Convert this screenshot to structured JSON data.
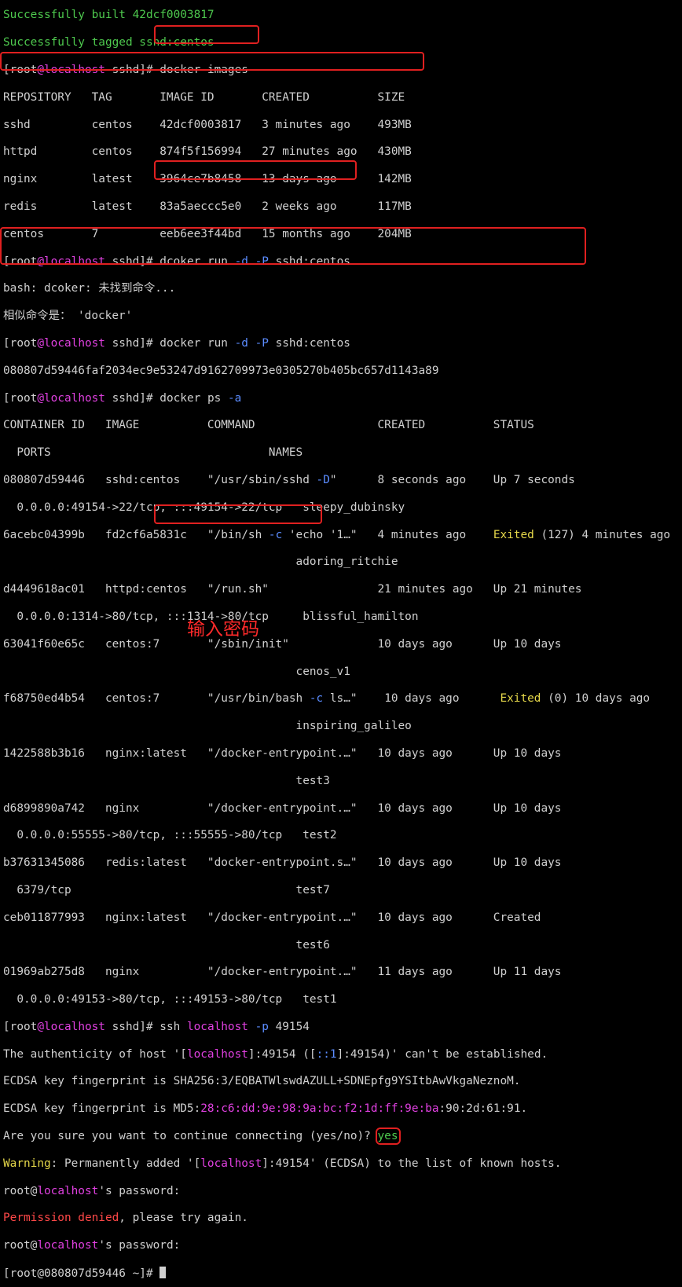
{
  "prompt": {
    "user": "root",
    "at": "@",
    "host": "localhost",
    "dir": " sshd]# ",
    "open": "["
  },
  "build": {
    "built": "Successfully built 42dcf0003817",
    "tagged": "Successfully tagged sshd:centos"
  },
  "cmd_images": "docker images",
  "images_header": "REPOSITORY   TAG       IMAGE ID       CREATED          SIZE",
  "images": [
    "sshd         centos    42dcf0003817   3 minutes ago    493MB",
    "httpd        centos    874f5f156994   27 minutes ago   430MB",
    "nginx        latest    3964ce7b8458   13 days ago      142MB",
    "redis        latest    83a5aeccc5e0   2 weeks ago      117MB",
    "centos       7         eeb6ee3f44bd   15 months ago    204MB"
  ],
  "typo_cmd": {
    "a": "dcoker run ",
    "d": "-d",
    "m": " ",
    "p": "-P",
    "z": " sshd:centos"
  },
  "bash_err": "bash: dcoker: 未找到命令...",
  "similar": "相似命令是： 'docker'",
  "run_cmd": {
    "a": "docker run ",
    "d": "-d",
    "m": " ",
    "p": "-P",
    "z": " sshd:centos"
  },
  "run_id": "080807d59446faf2034ec9e53247d9162709973e0305270b405bc657d1143a89",
  "ps_cmd": {
    "a": "docker ps ",
    "f": "-a"
  },
  "ps_header1": "CONTAINER ID   IMAGE          COMMAND                  CREATED          STATUS",
  "ps_header2": "  PORTS                                NAMES",
  "ps": {
    "r1a": "080807d59446   sshd:centos    \"/usr/sbin/sshd ",
    "r1f": "-D",
    "r1b": "\"      8 seconds ago    Up 7 seconds",
    "r1p": "  0.0.0.0:49154->22/tcp, :::49154->22/tcp   sleepy_dubinsky",
    "r2a": "6acebc04399b   fd2cf6a5831c   \"/bin/sh ",
    "r2f": "-c",
    "r2b": " 'echo '1…\"   4 minutes ago    ",
    "r2s": "Exited",
    "r2c": " (127) 4 minutes ago",
    "r2n": "                                           adoring_ritchie",
    "r3a": "d4449618ac01   httpd:centos   \"/run.sh\"                21 minutes ago   Up 21 minutes",
    "r3p": "  0.0.0.0:1314->80/tcp, :::1314->80/tcp     blissful_hamilton",
    "r4a": "63041f60e65c   centos:7       \"/sbin/init\"             10 days ago      Up 10 days",
    "r4n": "                                           cenos_v1",
    "r5a": "f68750ed4b54   centos:7       \"/usr/bin/bash ",
    "r5f": "-c",
    "r5b": " ls…\"    10 days ago      ",
    "r5s": "Exited",
    "r5c": " (0) 10 days ago",
    "r5n": "                                           inspiring_galileo",
    "r6a": "1422588b3b16   nginx:latest   \"/docker-entrypoint.…\"   10 days ago      Up 10 days",
    "r6n": "                                           test3",
    "r7a": "d6899890a742   nginx          \"/docker-entrypoint.…\"   10 days ago      Up 10 days",
    "r7p": "  0.0.0.0:55555->80/tcp, :::55555->80/tcp   test2",
    "r8a": "b37631345086   redis:latest   \"docker-entrypoint.s…\"   10 days ago      Up 10 days",
    "r8p": "  6379/tcp                                 test7",
    "r9a": "ceb011877993   nginx:latest   \"/docker-entrypoint.…\"   10 days ago      Created",
    "r9n": "                                           test6",
    "r10a": "01969ab275d8   nginx          \"/docker-entrypoint.…\"   11 days ago      Up 11 days",
    "r10p": "  0.0.0.0:49153->80/tcp, :::49153->80/tcp   test1"
  },
  "ssh_cmd": {
    "a": "ssh ",
    "h": "localhost",
    "m": " ",
    "p": "-p",
    "z": " 49154"
  },
  "auth": {
    "a": "The authenticity of host '[",
    "h": "localhost",
    "b": "]:49154 ([",
    "c": "::1",
    "d": "]:49154)' can't be established."
  },
  "fp1": "ECDSA key fingerprint is SHA256:3/EQBATWlswdAZULL+SDNEpfg9YSItbAwVkgaNeznoM.",
  "fp2": {
    "a": "ECDSA key fingerprint is MD5:",
    "m": "28:c6:dd:9e:98:9a:bc:f2:1d:ff:9e:ba",
    "b": ":90:2d:61:91."
  },
  "sure": {
    "a": "Are you sure you want to continue connecting (yes/no)? ",
    "y": "yes"
  },
  "warn": {
    "w": "Warning",
    "a": ": Permanently added '[",
    "h": "localhost",
    "b": "]:49154' (ECDSA) to the list of known hosts."
  },
  "pw1": {
    "u": "root@",
    "h": "localhost",
    "s": "'s password:"
  },
  "denied": {
    "p": "Permission denied",
    "s": ", please try again."
  },
  "pw2": {
    "u": "root@",
    "h": "localhost",
    "s": "'s password: "
  },
  "final_prompt": "[root@080807d59446 ~]# ",
  "annotation": "输入密码"
}
